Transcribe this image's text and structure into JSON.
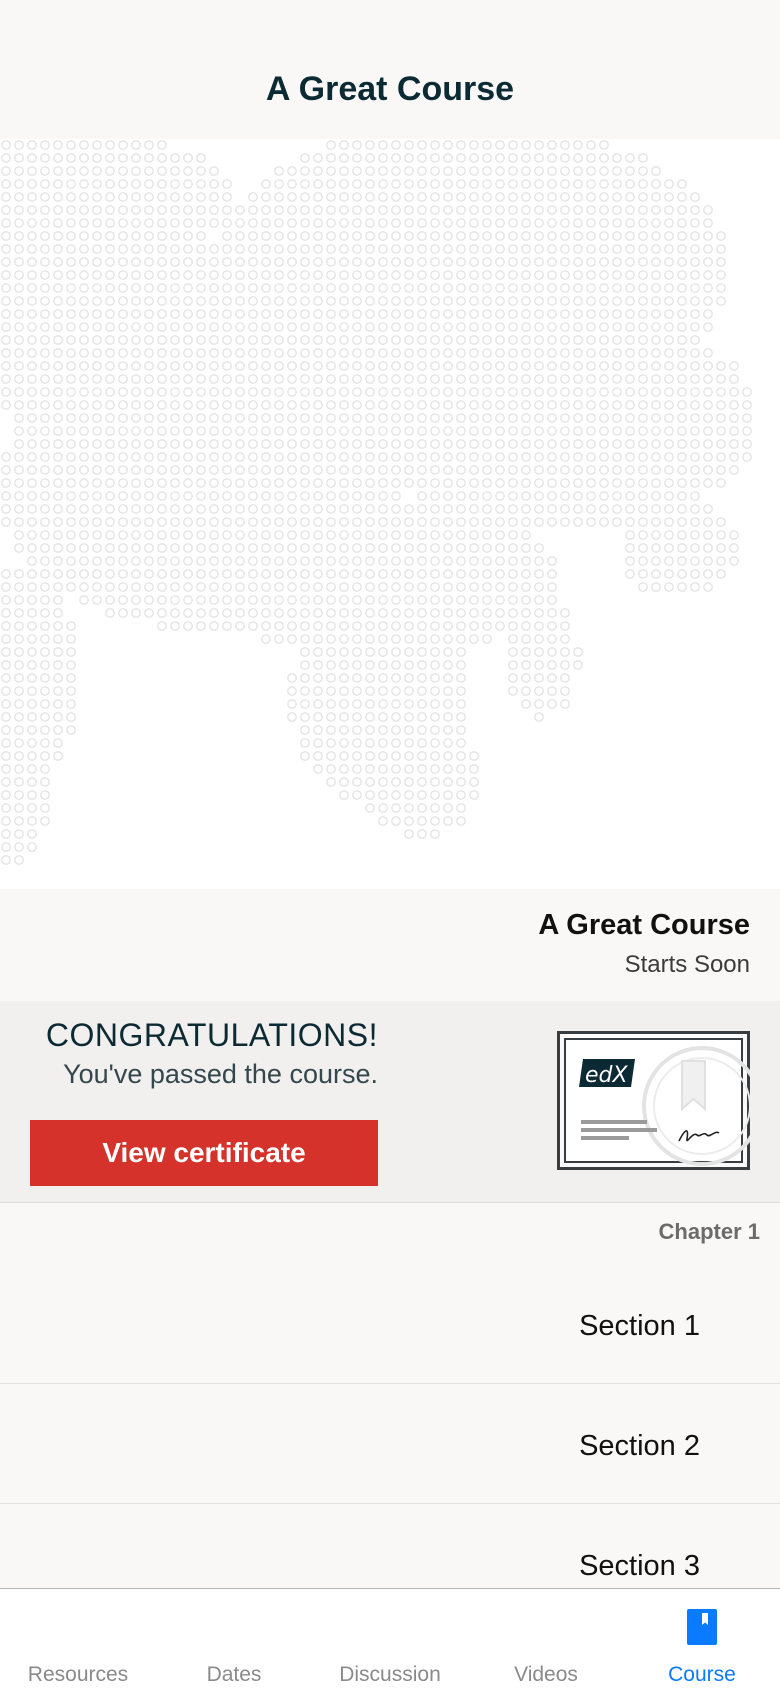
{
  "header": {
    "title": "A Great Course"
  },
  "course": {
    "name": "A Great Course",
    "status": "Starts Soon"
  },
  "certificate": {
    "title": "CONGRATULATIONS!",
    "message": "You've passed the course.",
    "button_label": "View certificate",
    "logo_text": "edX"
  },
  "outline": {
    "chapter": "Chapter 1",
    "sections": [
      "Section 1",
      "Section 2",
      "Section 3"
    ]
  },
  "tabs": [
    {
      "label": "Resources",
      "active": false
    },
    {
      "label": "Dates",
      "active": false
    },
    {
      "label": "Discussion",
      "active": false
    },
    {
      "label": "Videos",
      "active": false
    },
    {
      "label": "Course",
      "active": true,
      "icon": "bookmark-icon"
    }
  ],
  "colors": {
    "accent": "#0a7bff",
    "button": "#d5322b",
    "title": "#0b2a33"
  }
}
